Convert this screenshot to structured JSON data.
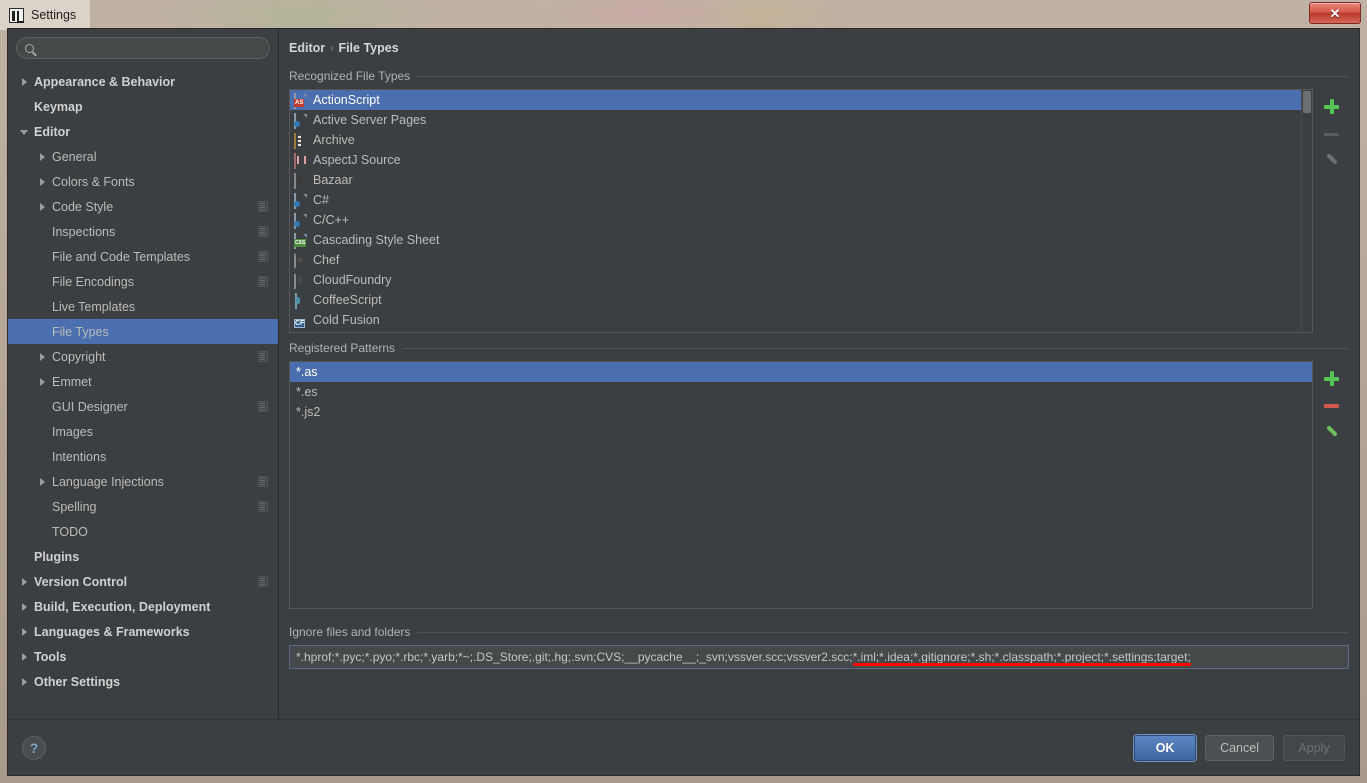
{
  "window": {
    "title": "Settings",
    "close_label": "✕"
  },
  "search": {
    "value": "",
    "placeholder": ""
  },
  "sidebar": {
    "items": [
      {
        "label": "Appearance & Behavior",
        "arrow": "right",
        "indent": 0,
        "bold": true,
        "cfg": false,
        "selected": false
      },
      {
        "label": "Keymap",
        "arrow": "none",
        "indent": 0,
        "bold": true,
        "cfg": false,
        "selected": false
      },
      {
        "label": "Editor",
        "arrow": "down",
        "indent": 0,
        "bold": true,
        "cfg": false,
        "selected": false
      },
      {
        "label": "General",
        "arrow": "right",
        "indent": 1,
        "bold": false,
        "cfg": false,
        "selected": false
      },
      {
        "label": "Colors & Fonts",
        "arrow": "right",
        "indent": 1,
        "bold": false,
        "cfg": false,
        "selected": false
      },
      {
        "label": "Code Style",
        "arrow": "right",
        "indent": 1,
        "bold": false,
        "cfg": true,
        "selected": false
      },
      {
        "label": "Inspections",
        "arrow": "none",
        "indent": 1,
        "bold": false,
        "cfg": true,
        "selected": false
      },
      {
        "label": "File and Code Templates",
        "arrow": "none",
        "indent": 1,
        "bold": false,
        "cfg": true,
        "selected": false
      },
      {
        "label": "File Encodings",
        "arrow": "none",
        "indent": 1,
        "bold": false,
        "cfg": true,
        "selected": false
      },
      {
        "label": "Live Templates",
        "arrow": "none",
        "indent": 1,
        "bold": false,
        "cfg": false,
        "selected": false
      },
      {
        "label": "File Types",
        "arrow": "none",
        "indent": 1,
        "bold": false,
        "cfg": false,
        "selected": true
      },
      {
        "label": "Copyright",
        "arrow": "right",
        "indent": 1,
        "bold": false,
        "cfg": true,
        "selected": false
      },
      {
        "label": "Emmet",
        "arrow": "right",
        "indent": 1,
        "bold": false,
        "cfg": false,
        "selected": false
      },
      {
        "label": "GUI Designer",
        "arrow": "none",
        "indent": 1,
        "bold": false,
        "cfg": true,
        "selected": false
      },
      {
        "label": "Images",
        "arrow": "none",
        "indent": 1,
        "bold": false,
        "cfg": false,
        "selected": false
      },
      {
        "label": "Intentions",
        "arrow": "none",
        "indent": 1,
        "bold": false,
        "cfg": false,
        "selected": false
      },
      {
        "label": "Language Injections",
        "arrow": "right",
        "indent": 1,
        "bold": false,
        "cfg": true,
        "selected": false
      },
      {
        "label": "Spelling",
        "arrow": "none",
        "indent": 1,
        "bold": false,
        "cfg": true,
        "selected": false
      },
      {
        "label": "TODO",
        "arrow": "none",
        "indent": 1,
        "bold": false,
        "cfg": false,
        "selected": false
      },
      {
        "label": "Plugins",
        "arrow": "none",
        "indent": 0,
        "bold": true,
        "cfg": false,
        "selected": false
      },
      {
        "label": "Version Control",
        "arrow": "right",
        "indent": 0,
        "bold": true,
        "cfg": true,
        "selected": false
      },
      {
        "label": "Build, Execution, Deployment",
        "arrow": "right",
        "indent": 0,
        "bold": true,
        "cfg": false,
        "selected": false
      },
      {
        "label": "Languages & Frameworks",
        "arrow": "right",
        "indent": 0,
        "bold": true,
        "cfg": false,
        "selected": false
      },
      {
        "label": "Tools",
        "arrow": "right",
        "indent": 0,
        "bold": true,
        "cfg": false,
        "selected": false
      },
      {
        "label": "Other Settings",
        "arrow": "right",
        "indent": 0,
        "bold": true,
        "cfg": false,
        "selected": false
      }
    ]
  },
  "breadcrumb": {
    "parent": "Editor",
    "separator": "›",
    "current": "File Types"
  },
  "recognized": {
    "title": "Recognized File Types",
    "items": [
      {
        "label": "ActionScript",
        "icon": "actionscript-file-icon",
        "selected": true
      },
      {
        "label": "Active Server Pages",
        "icon": "asp-file-icon",
        "selected": false
      },
      {
        "label": "Archive",
        "icon": "archive-file-icon",
        "selected": false
      },
      {
        "label": "AspectJ Source",
        "icon": "aspectj-file-icon",
        "selected": false
      },
      {
        "label": "Bazaar",
        "icon": "bazaar-file-icon",
        "selected": false
      },
      {
        "label": "C#",
        "icon": "csharp-file-icon",
        "selected": false
      },
      {
        "label": "C/C++",
        "icon": "cpp-file-icon",
        "selected": false
      },
      {
        "label": "Cascading Style Sheet",
        "icon": "css-file-icon",
        "selected": false
      },
      {
        "label": "Chef",
        "icon": "chef-file-icon",
        "selected": false
      },
      {
        "label": "CloudFoundry",
        "icon": "cloudfoundry-file-icon",
        "selected": false
      },
      {
        "label": "CoffeeScript",
        "icon": "coffeescript-file-icon",
        "selected": false
      },
      {
        "label": "Cold Fusion",
        "icon": "coldfusion-file-icon",
        "selected": false
      }
    ],
    "toolbar": {
      "add_label": "+",
      "remove_label": "−",
      "edit_label": "✎"
    }
  },
  "patterns": {
    "title": "Registered Patterns",
    "items": [
      {
        "label": "*.as",
        "selected": true
      },
      {
        "label": "*.es",
        "selected": false
      },
      {
        "label": "*.js2",
        "selected": false
      }
    ],
    "toolbar": {
      "add_label": "+",
      "remove_label": "−",
      "edit_label": "✎"
    }
  },
  "ignore": {
    "title": "Ignore files and folders",
    "value": "*.hprof;*.pyc;*.pyo;*.rbc;*.yarb;*~;.DS_Store;.git;.hg;.svn;CVS;__pycache__;_svn;vssver.scc;vssver2.scc;*.iml;*.idea;*.gitignore;*.sh;*.classpath;*.project;*.settings;target;",
    "highlight_color": "#ff0000"
  },
  "footer": {
    "help_label": "?",
    "ok_label": "OK",
    "cancel_label": "Cancel",
    "apply_label": "Apply"
  },
  "colors": {
    "selection": "#4b6eaf",
    "panel_bg": "#3c3f41",
    "text": "#bbbbbb",
    "error_underline": "#ff0000"
  }
}
